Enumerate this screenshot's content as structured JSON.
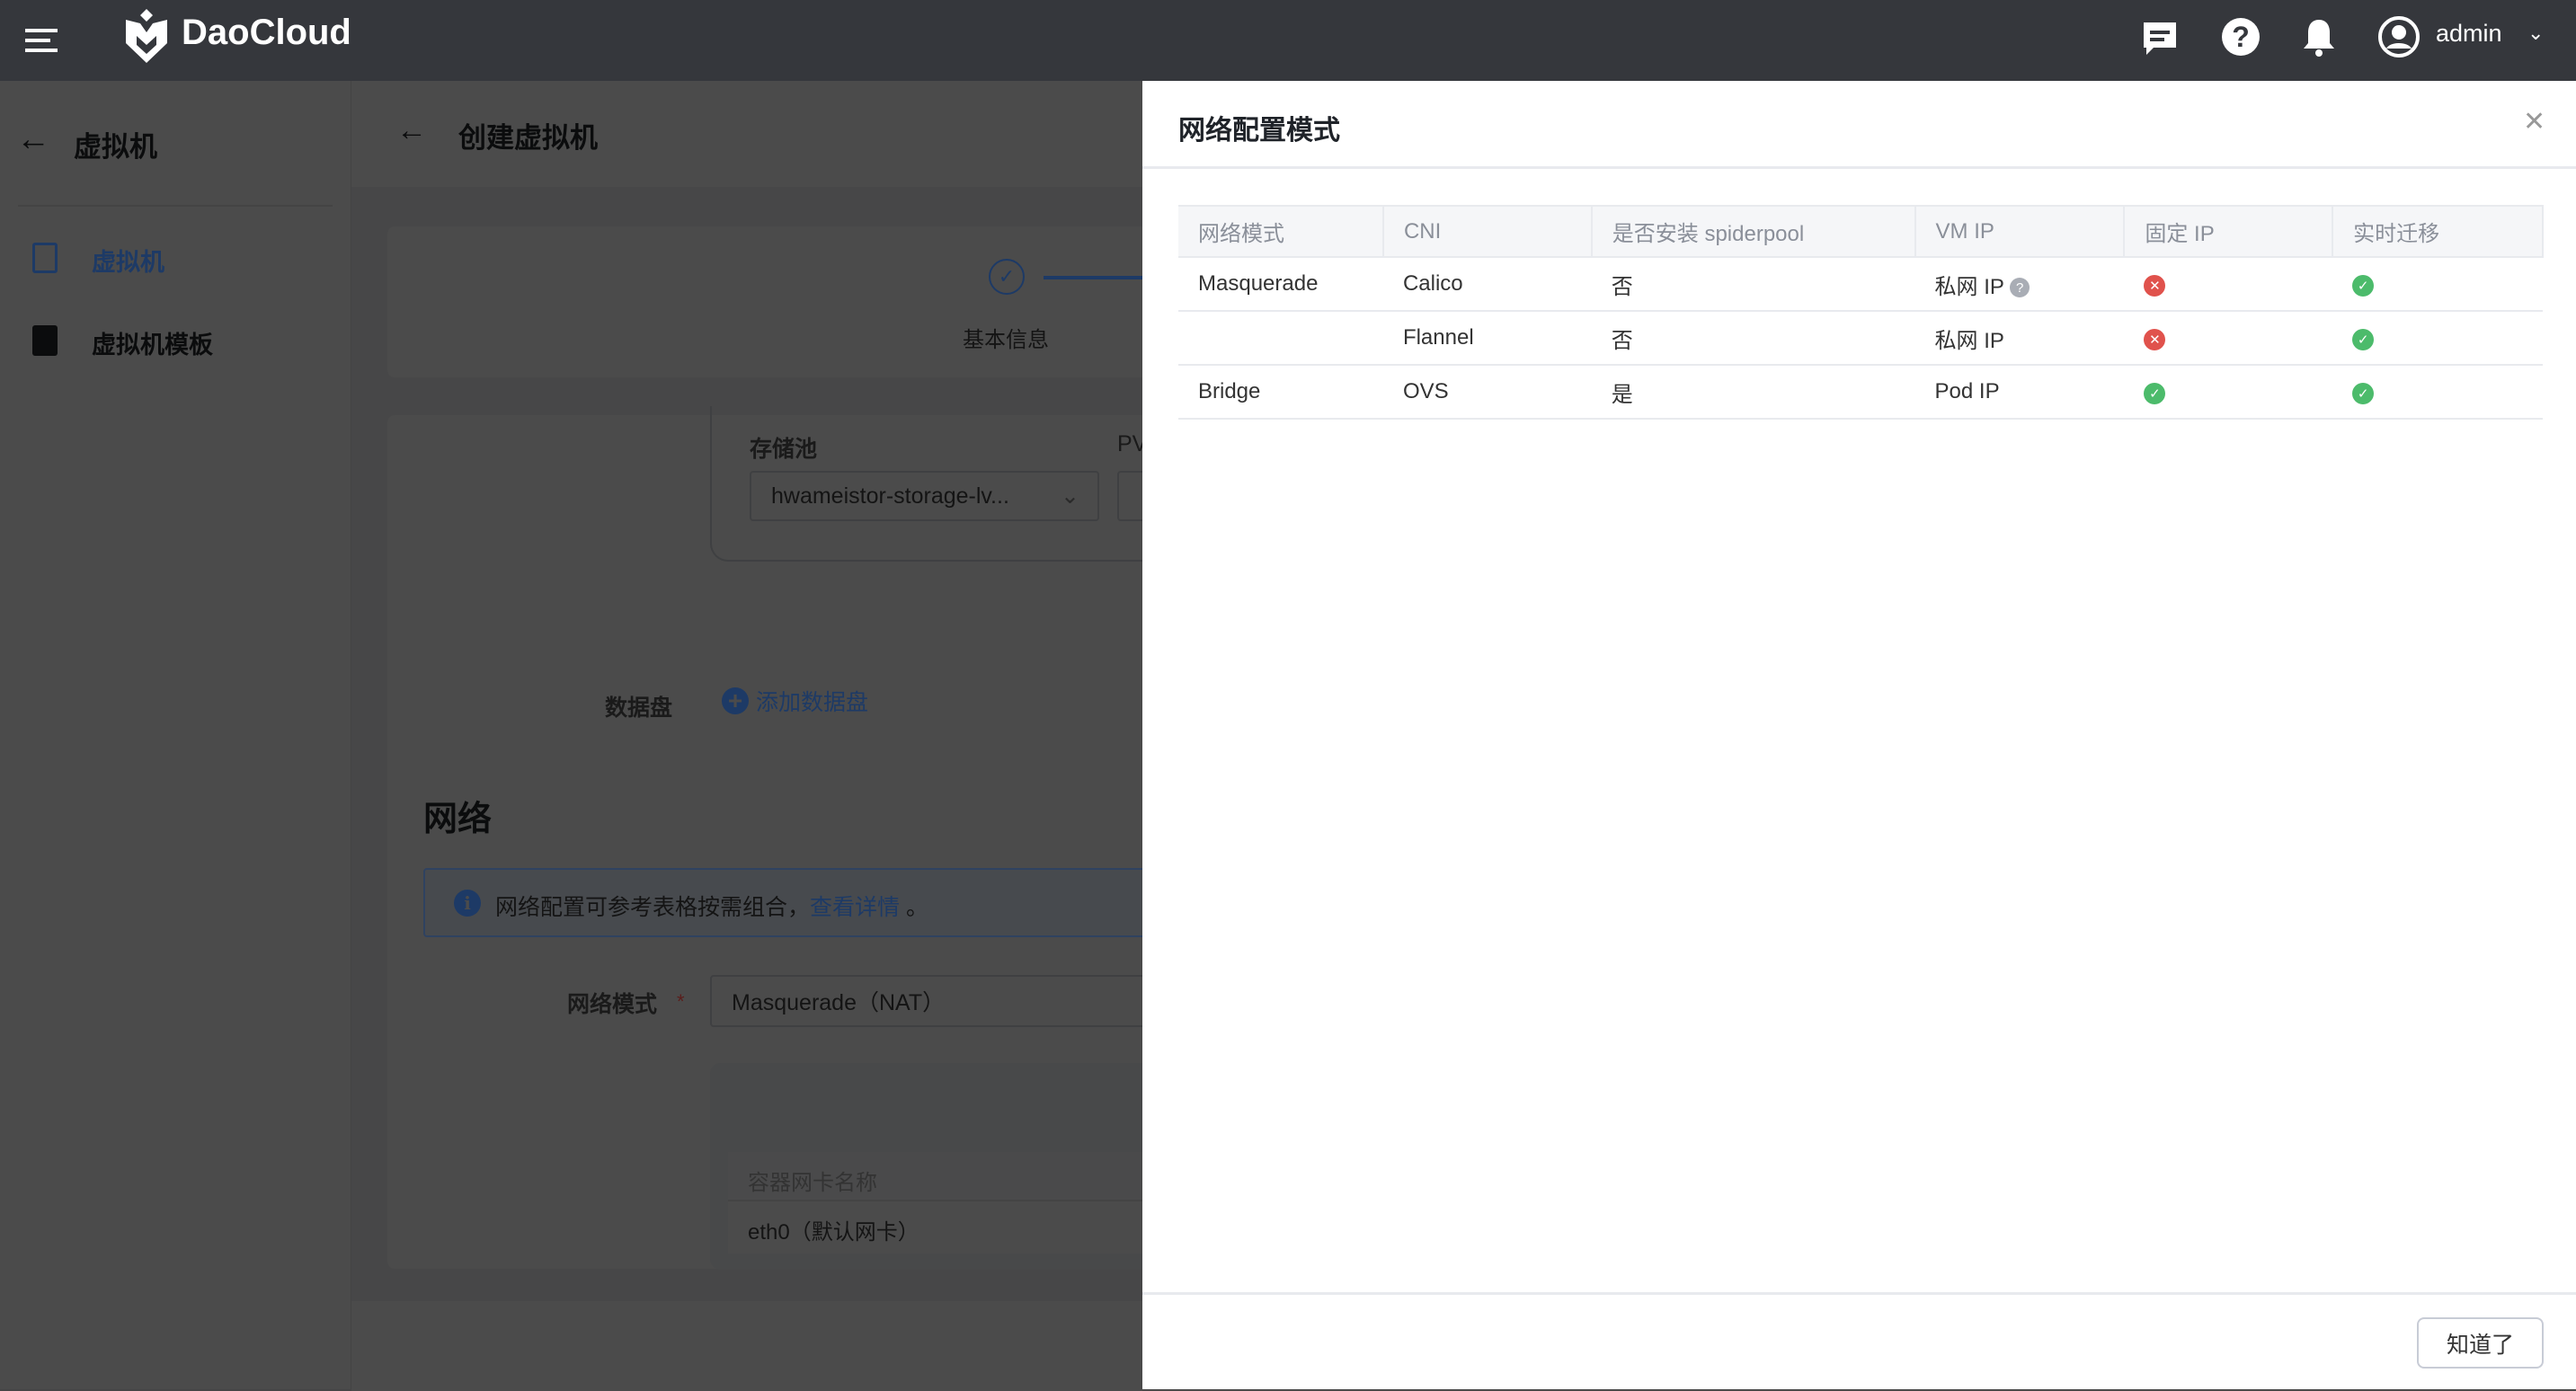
{
  "topbar": {
    "brand": "DaoCloud",
    "user": "admin"
  },
  "sidebar": {
    "title": "虚拟机",
    "items": [
      {
        "label": "虚拟机",
        "active": true
      },
      {
        "label": "虚拟机模板",
        "active": false
      }
    ]
  },
  "page": {
    "title": "创建虚拟机",
    "step1": "基本信息",
    "storage_pool_label": "存储池",
    "storage_pool_value": "hwameistor-storage-lv...",
    "pv_label": "PV",
    "data_disk_label": "数据盘",
    "add_data_disk": "添加数据盘",
    "network_heading": "网络",
    "info_text": "网络配置可参考表格按需组合，",
    "info_link": "查看详情",
    "info_end": "。",
    "network_mode_label": "网络模式",
    "required_mark": "*",
    "network_mode_value": "Masquerade（NAT）",
    "nic_header": "容器网卡名称",
    "nic_value": "eth0（默认网卡）"
  },
  "drawer": {
    "title": "网络配置模式",
    "ok_button": "知道了",
    "columns": [
      "网络模式",
      "CNI",
      "是否安装 spiderpool",
      "VM IP",
      "固定 IP",
      "实时迁移"
    ],
    "rows": [
      {
        "mode": "Masquerade",
        "cni": "Calico",
        "spiderpool": "否",
        "vmip": "私网 IP",
        "help": true,
        "fixed_ip": "no",
        "live_migration": "yes"
      },
      {
        "mode": "",
        "cni": "Flannel",
        "spiderpool": "否",
        "vmip": "私网 IP",
        "help": false,
        "fixed_ip": "no",
        "live_migration": "yes"
      },
      {
        "mode": "Bridge",
        "cni": "OVS",
        "spiderpool": "是",
        "vmip": "Pod IP",
        "help": false,
        "fixed_ip": "yes",
        "live_migration": "yes"
      }
    ]
  },
  "colors": {
    "accent": "#2f6fd1",
    "yes": "#4cbb6b",
    "no": "#e0524c",
    "topbar": "#35373c"
  }
}
